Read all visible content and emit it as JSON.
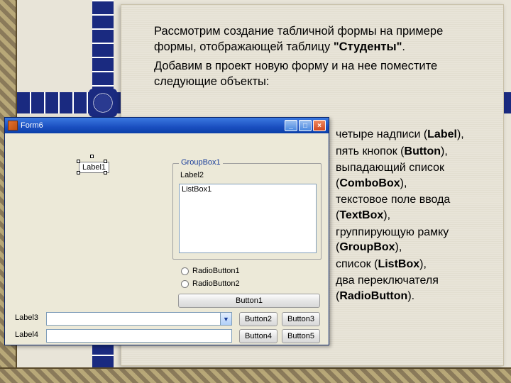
{
  "intro": {
    "line1": "Рассмотрим создание табличной формы на примере формы, отображающей таблицу ",
    "bold1": "\"Студенты\"",
    "end1": ".",
    "line2": "Добавим в проект новую форму и на нее поместите следующие объекты:"
  },
  "bullets": [
    {
      "pre": "четыре надписи (",
      "bold": "Label",
      "post": "),"
    },
    {
      "pre": "пять кнопок (",
      "bold": "Button",
      "post": "),"
    },
    {
      "pre": "выпадающий список (",
      "bold": "ComboBox",
      "post": "),"
    },
    {
      "pre": "текстовое поле ввода (",
      "bold": "TextBox",
      "post": "),"
    },
    {
      "pre": "группирующую рамку (",
      "bold": "GroupBox",
      "post": "),"
    },
    {
      "pre": "список (",
      "bold": "ListBox",
      "post": "),"
    },
    {
      "pre": "два переключателя (",
      "bold": "RadioButton",
      "post": ")."
    }
  ],
  "form": {
    "title": "Form6",
    "label1": "Label1",
    "groupbox": "GroupBox1",
    "label2": "Label2",
    "listbox": "ListBox1",
    "radio1": "RadioButton1",
    "radio2": "RadioButton2",
    "button1": "Button1",
    "button2": "Button2",
    "button3": "Button3",
    "button4": "Button4",
    "button5": "Button5",
    "label3": "Label3",
    "label4": "Label4",
    "combo_value": "",
    "text_value": ""
  }
}
